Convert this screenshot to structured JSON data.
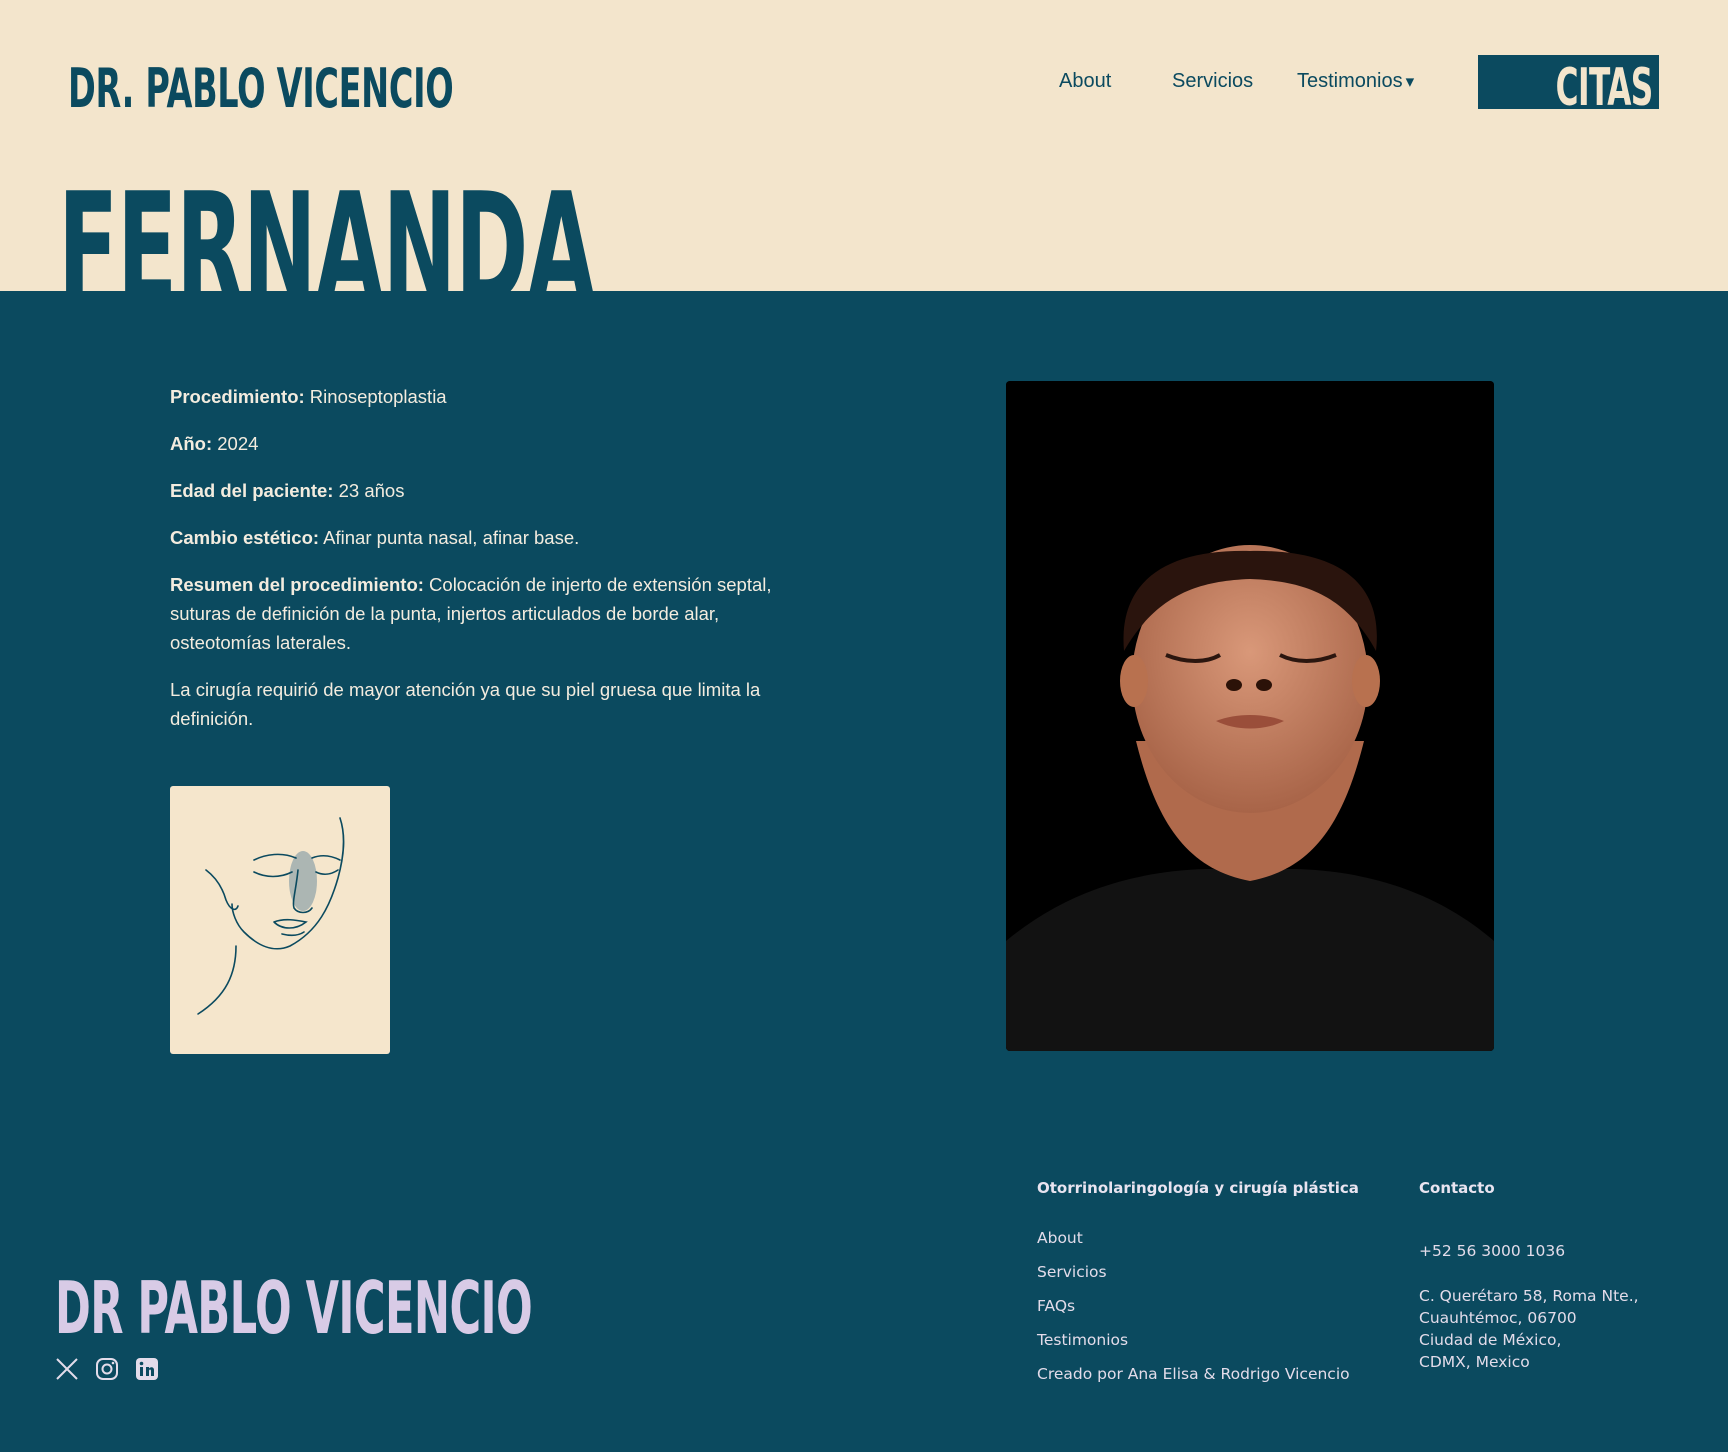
{
  "header": {
    "logo": "DR. PABLO VICENCIO",
    "nav": [
      "About",
      "Servicios",
      "Testimonios"
    ],
    "caret": "▾",
    "cta": "CITAS"
  },
  "hero": {
    "name": "FERNANDA"
  },
  "details": {
    "procedimiento_label": "Procedimiento:",
    "procedimiento_value": " Rinoseptoplastia",
    "anio_label": "Año:",
    "anio_value": " 2024",
    "edad_label": "Edad del paciente:",
    "edad_value": " 23 años",
    "cambio_label": "Cambio estético:",
    "cambio_value": " Afinar punta nasal, afinar base.",
    "resumen_label": "Resumen del procedimiento:",
    "resumen_value": " Colocación de injerto de extensión septal, suturas de definición de la punta, injertos articulados de borde alar, osteotomías laterales.",
    "nota": "La cirugía requirió de mayor atención ya que su piel gruesa que limita la definición."
  },
  "footer": {
    "logo": "DR PABLO VICENCIO",
    "col1_title": "Otorrinolaringología y cirugía plástica",
    "links": [
      "About",
      "Servicios",
      "FAQs",
      "Testimonios",
      "Creado por Ana Elisa & Rodrigo Vicencio"
    ],
    "col2_title": "Contacto",
    "phone": "+52 56 3000 1036",
    "address": [
      "C. Querétaro 58, Roma Nte.,",
      "Cuauhtémoc, 06700",
      "Ciudad de México,",
      "CDMX, Mexico"
    ]
  },
  "colors": {
    "navy": "#0b4a5f",
    "cream": "#f3e5cc",
    "lavender": "#d8cbe6"
  }
}
